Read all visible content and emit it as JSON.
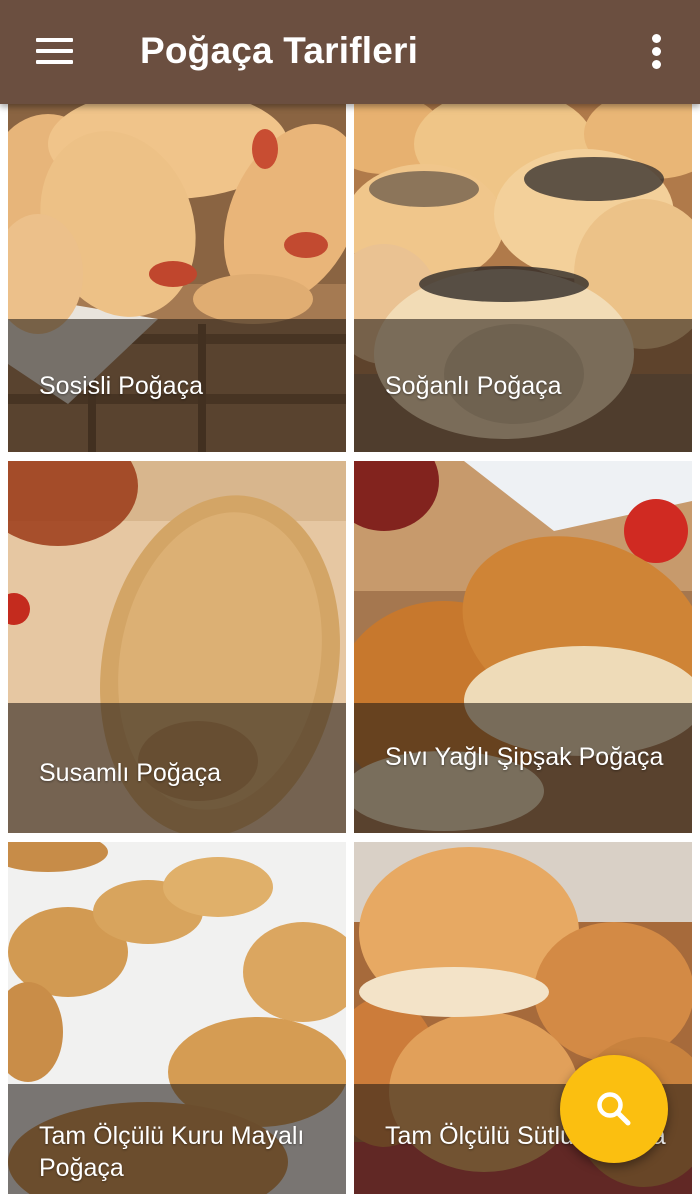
{
  "app": {
    "title": "Poğaça Tarifleri",
    "menu_icon": "hamburger-menu-icon",
    "overflow_icon": "more-vert-icon",
    "bar_color": "#6b4f40"
  },
  "recipes": [
    {
      "label": "Sosisli Poğaça"
    },
    {
      "label": "Soğanlı Poğaça"
    },
    {
      "label": "Susamlı Poğaça"
    },
    {
      "label": "Sıvı Yağlı Şipşak Poğaça"
    },
    {
      "label": "Tam Ölçülü Kuru Mayalı Poğaça"
    },
    {
      "label": "Tam Ölçülü Sütlü Poğaça"
    }
  ],
  "fab": {
    "icon": "search-icon",
    "color": "#fbbf10"
  }
}
